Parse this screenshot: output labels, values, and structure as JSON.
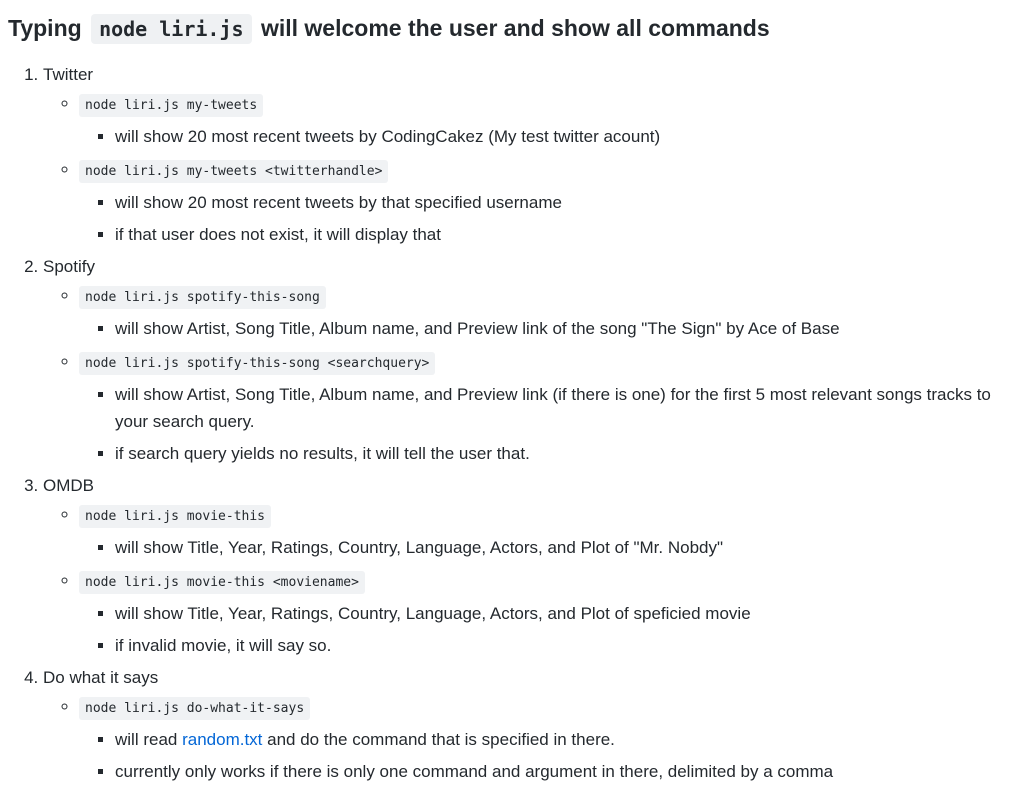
{
  "heading": {
    "prefix": "Typing",
    "code": "node liri.js",
    "suffix": "will welcome the user and show all commands"
  },
  "sections": [
    {
      "title": "Twitter",
      "commands": [
        {
          "code": "node liri.js my-tweets",
          "details": [
            "will show 20 most recent tweets by CodingCakez (My test twitter acount)"
          ]
        },
        {
          "code": "node liri.js my-tweets <twitterhandle>",
          "details": [
            "will show 20 most recent tweets by that specified username",
            "if that user does not exist, it will display that"
          ]
        }
      ]
    },
    {
      "title": "Spotify",
      "commands": [
        {
          "code": "node liri.js spotify-this-song",
          "details": [
            "will show Artist, Song Title, Album name, and Preview link of the song \"The Sign\" by Ace of Base"
          ]
        },
        {
          "code": "node liri.js spotify-this-song <searchquery>",
          "details": [
            "will show Artist, Song Title, Album name, and Preview link (if there is one) for the first 5 most relevant songs tracks to your search query.",
            "if search query yields no results, it will tell the user that."
          ]
        }
      ]
    },
    {
      "title": "OMDB",
      "commands": [
        {
          "code": "node liri.js movie-this",
          "details": [
            "will show Title, Year, Ratings, Country, Language, Actors, and Plot of \"Mr. Nobdy\""
          ]
        },
        {
          "code": "node liri.js movie-this <moviename>",
          "details": [
            "will show Title, Year, Ratings, Country, Language, Actors, and Plot of speficied movie",
            "if invalid movie, it will say so."
          ]
        }
      ]
    },
    {
      "title": "Do what it says",
      "commands": [
        {
          "code": "node liri.js do-what-it-says",
          "details_rich": {
            "read_prefix": "will read",
            "read_link": "random.txt",
            "read_suffix": "and do the command that is specified in there."
          },
          "details": [
            "currently only works if there is only one command and argument in there, delimited by a comma"
          ]
        }
      ]
    }
  ]
}
